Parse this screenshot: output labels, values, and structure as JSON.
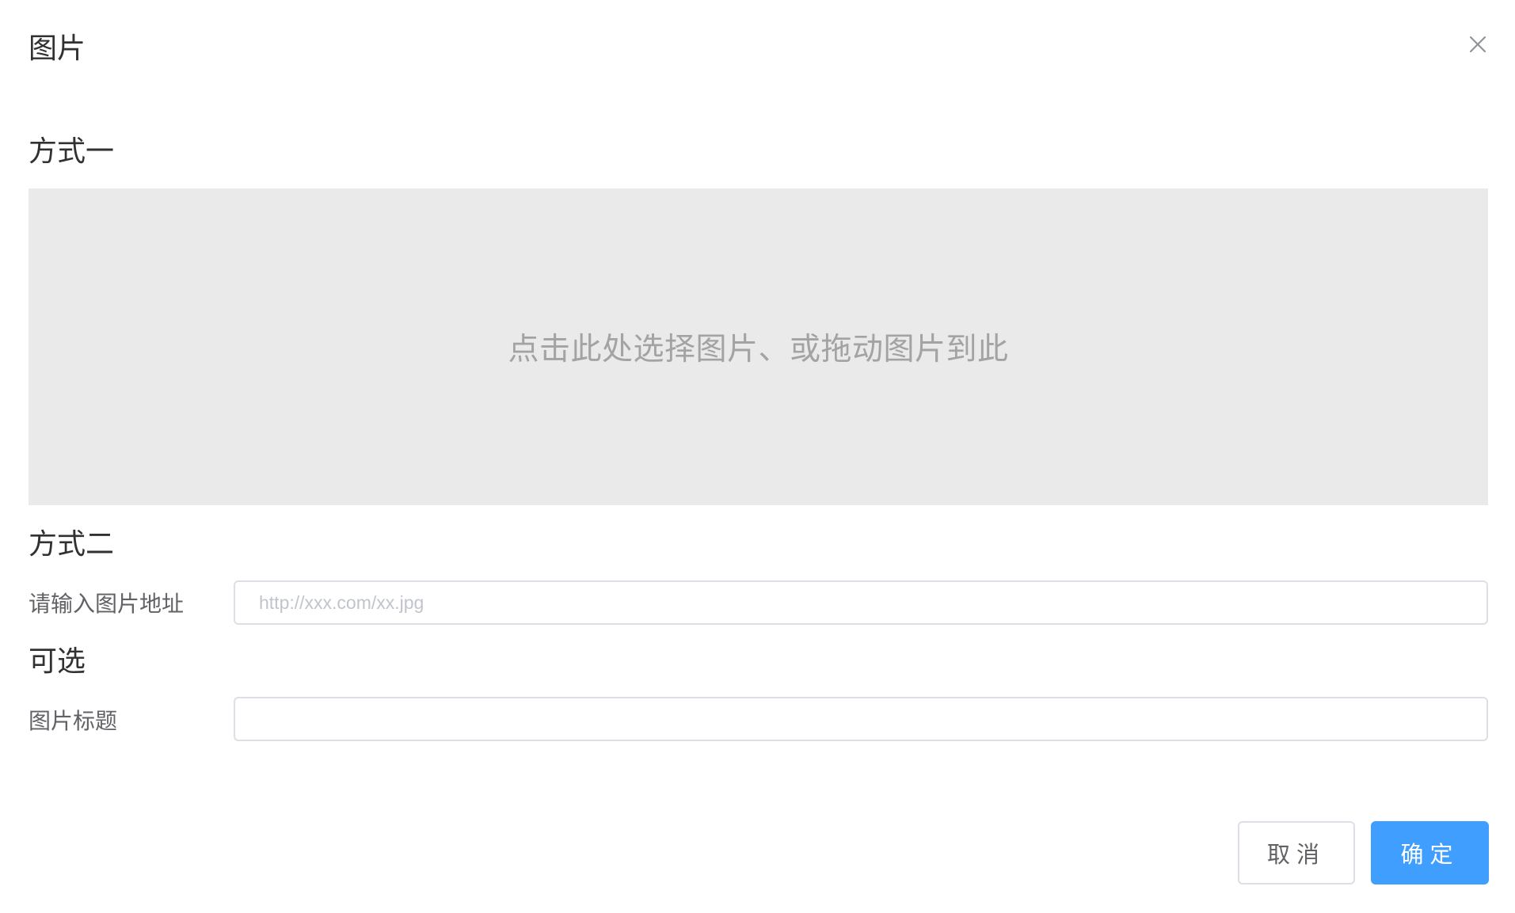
{
  "dialog": {
    "title": "图片"
  },
  "method_one": {
    "heading": "方式一",
    "upload_hint": "点击此处选择图片、或拖动图片到此"
  },
  "method_two": {
    "heading": "方式二",
    "url_label": "请输入图片地址",
    "url_placeholder": "http://xxx.com/xx.jpg",
    "url_value": ""
  },
  "optional": {
    "heading": "可选",
    "caption_label": "图片标题",
    "caption_value": ""
  },
  "footer": {
    "cancel_label": "取消",
    "confirm_label": "确定"
  },
  "colors": {
    "primary": "#409eff",
    "upload_bg": "#eaeaea",
    "border": "#dcdfe6"
  },
  "icons": {
    "close": "close-icon"
  }
}
